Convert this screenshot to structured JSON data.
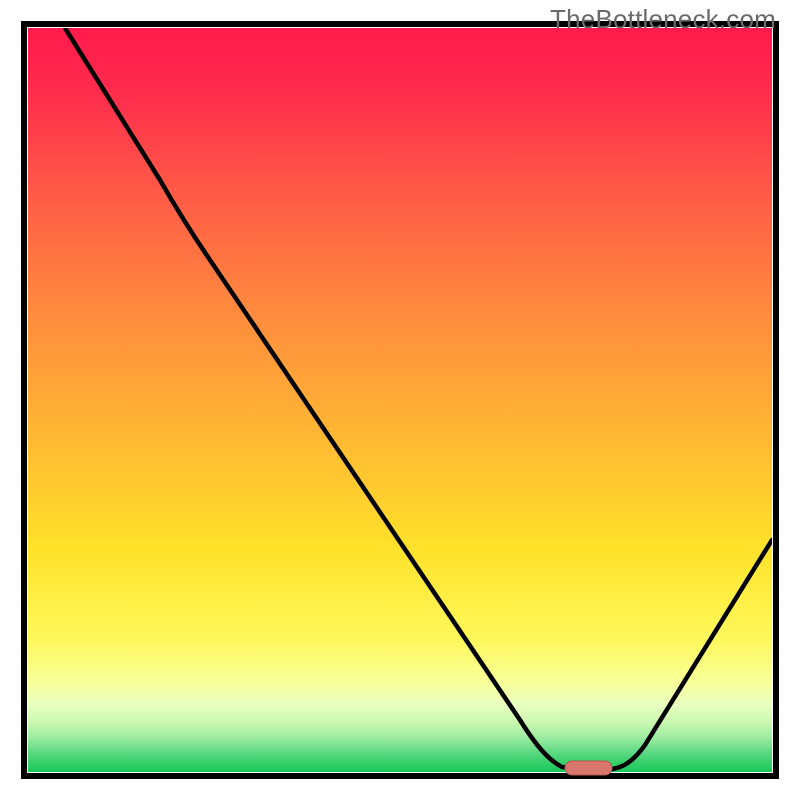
{
  "watermark": "TheBottleneck.com",
  "chart_data": {
    "type": "line",
    "title": "",
    "xlabel": "",
    "ylabel": "",
    "xlim": [
      0,
      100
    ],
    "ylim": [
      0,
      100
    ],
    "x": [
      5,
      22,
      40,
      58,
      68,
      71,
      75,
      80,
      100
    ],
    "values": [
      100,
      72,
      45,
      18,
      3,
      0,
      0,
      2,
      31
    ],
    "optimum_band": {
      "x_start": 73,
      "x_end": 78,
      "y": 0
    },
    "background": "vertical rainbow gradient (red → orange → yellow → green) with green compressed near bottom",
    "frame": true
  }
}
